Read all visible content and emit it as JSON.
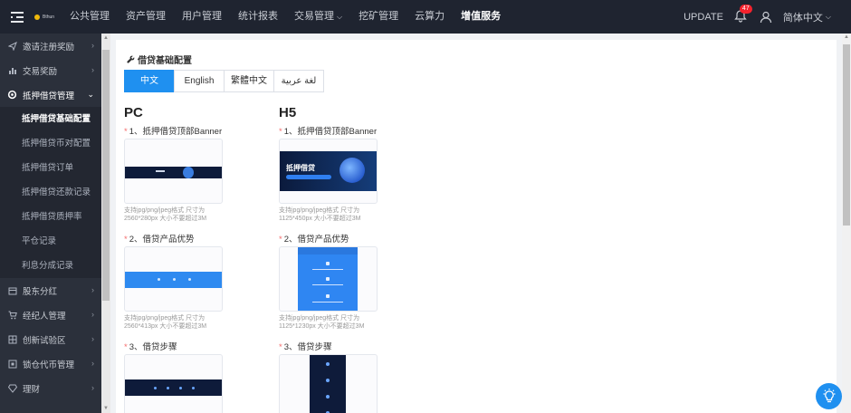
{
  "header": {
    "logo_text": "Bthun",
    "nav": [
      {
        "label": "公共管理",
        "active": false,
        "dropdown": false
      },
      {
        "label": "资产管理",
        "active": false,
        "dropdown": false
      },
      {
        "label": "用户管理",
        "active": false,
        "dropdown": false
      },
      {
        "label": "统计报表",
        "active": false,
        "dropdown": false
      },
      {
        "label": "交易管理",
        "active": false,
        "dropdown": true
      },
      {
        "label": "挖矿管理",
        "active": false,
        "dropdown": false
      },
      {
        "label": "云算力",
        "active": false,
        "dropdown": false
      },
      {
        "label": "增值服务",
        "active": true,
        "dropdown": false
      }
    ],
    "update_label": "UPDATE",
    "notification_count": "47",
    "language": "简体中文"
  },
  "sidebar": {
    "items": [
      {
        "label": "邀请注册奖励",
        "icon": "send-icon"
      },
      {
        "label": "交易奖励",
        "icon": "bar-chart-icon"
      },
      {
        "label": "抵押借贷管理",
        "icon": "gear-icon",
        "open": true
      },
      {
        "label": "股东分红",
        "icon": "box-icon"
      },
      {
        "label": "经纪人管理",
        "icon": "cart-icon"
      },
      {
        "label": "创新试验区",
        "icon": "grid-icon"
      },
      {
        "label": "锁仓代币管理",
        "icon": "lock-icon"
      },
      {
        "label": "理财",
        "icon": "diamond-icon"
      }
    ],
    "sub_items": [
      {
        "label": "抵押借贷基础配置",
        "active": true
      },
      {
        "label": "抵押借贷币对配置",
        "active": false
      },
      {
        "label": "抵押借贷订单",
        "active": false
      },
      {
        "label": "抵押借贷还款记录",
        "active": false
      },
      {
        "label": "抵押借贷质押率",
        "active": false
      },
      {
        "label": "平仓记录",
        "active": false
      },
      {
        "label": "利息分成记录",
        "active": false
      }
    ]
  },
  "main": {
    "title": "借贷基础配置",
    "tabs": [
      "中文",
      "English",
      "繁體中文",
      "لغة عربية"
    ],
    "active_tab": "中文",
    "pc": {
      "heading": "PC",
      "fields": [
        {
          "label": "1、抵押借贷顶部Banner",
          "hint": "支持jpg/png/jpeg格式 尺寸为2560*280px 大小不要超过3M"
        },
        {
          "label": "2、借贷产品优势",
          "hint": "支持jpg/png/jpeg格式 尺寸为2560*413px 大小不要超过3M"
        },
        {
          "label": "3、借贷步骤",
          "hint": ""
        }
      ]
    },
    "h5": {
      "heading": "H5",
      "banner_title": "抵押借贷",
      "fields": [
        {
          "label": "1、抵押借贷顶部Banner",
          "hint": "支持jpg/png/jpeg格式 尺寸为1125*450px 大小不要超过3M"
        },
        {
          "label": "2、借贷产品优势",
          "hint": "支持jpg/png/jpeg格式 尺寸为1125*1230px 大小不要超过3M"
        },
        {
          "label": "3、借贷步骤",
          "hint": ""
        }
      ]
    }
  },
  "colors": {
    "accent": "#1f90f0",
    "topbar": "#1f2430",
    "sidebar": "#2b303b"
  }
}
